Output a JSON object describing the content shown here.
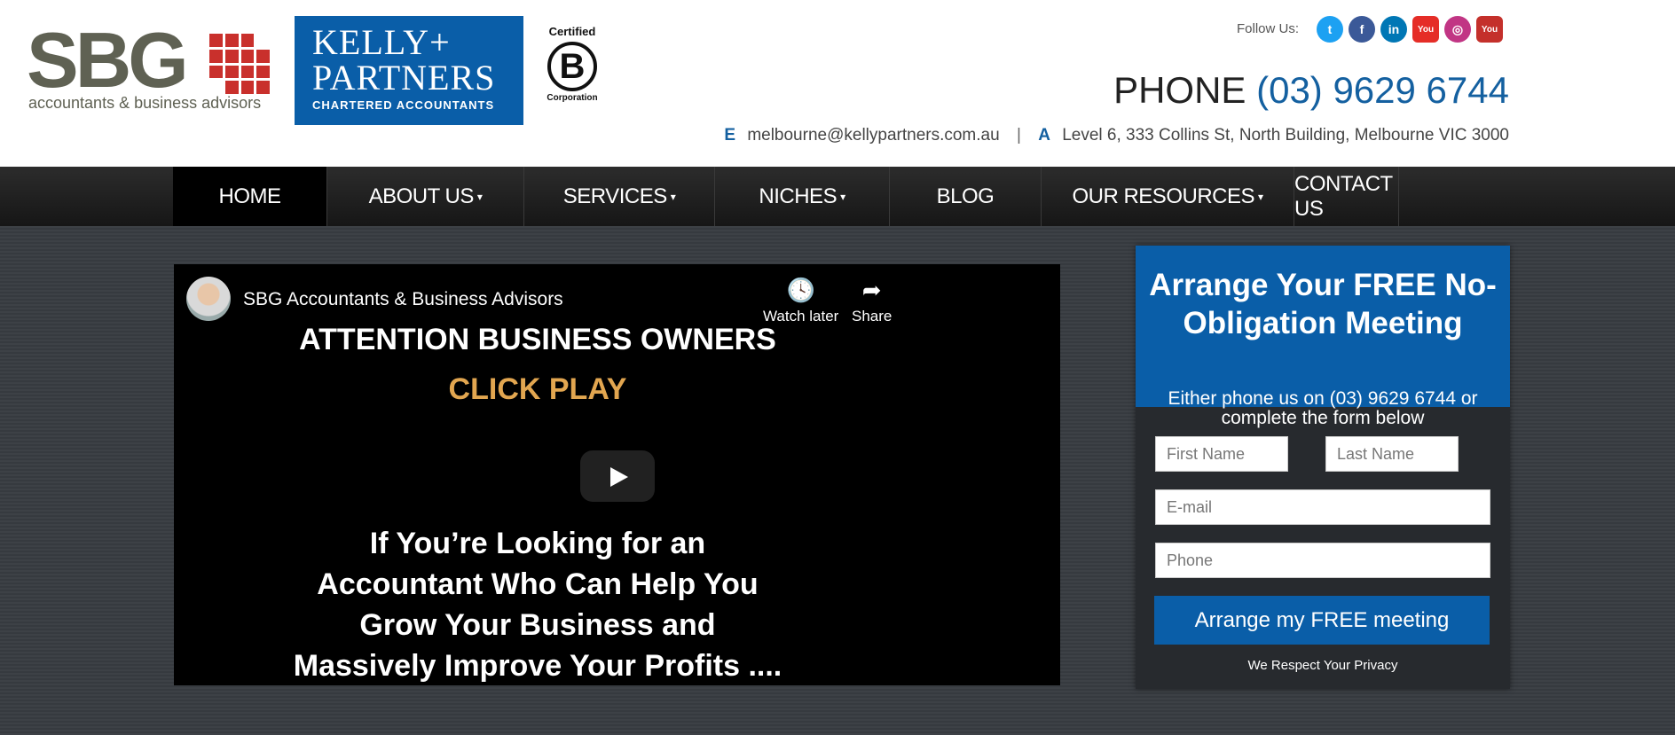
{
  "header": {
    "sbg_logo": {
      "wordmark": "SBG",
      "tagline": "accountants & business advisors"
    },
    "kp_logo": {
      "name_line1": "KELLY+",
      "name_line2": "PARTNERS",
      "sub": "CHARTERED ACCOUNTANTS"
    },
    "bcorp": {
      "top": "Certified",
      "letter": "B",
      "bottom": "Corporation"
    },
    "follow_label": "Follow Us:",
    "socials": [
      {
        "name": "twitter-icon",
        "glyph": "t",
        "color": "#1da1f2"
      },
      {
        "name": "facebook-icon",
        "glyph": "f",
        "color": "#3b5998"
      },
      {
        "name": "linkedin-icon",
        "glyph": "in",
        "color": "#0077b5"
      },
      {
        "name": "youtube-icon",
        "glyph": "You",
        "color": "#e52d27"
      },
      {
        "name": "instagram-icon",
        "glyph": "◎",
        "color": "#c13584"
      },
      {
        "name": "youtube-alt-icon",
        "glyph": "You",
        "color": "#c4302b"
      }
    ],
    "phone_label": "PHONE",
    "phone_number": "(03) 9629 6744",
    "email_label": "E",
    "email": "melbourne@kellypartners.com.au",
    "separator": "|",
    "address_label": "A",
    "address": "Level 6, 333 Collins St, North Building, Melbourne VIC 3000"
  },
  "nav": {
    "items": [
      {
        "label": "HOME",
        "dropdown": false,
        "active": true
      },
      {
        "label": "ABOUT US",
        "dropdown": true
      },
      {
        "label": "SERVICES",
        "dropdown": true
      },
      {
        "label": "NICHES",
        "dropdown": true
      },
      {
        "label": "BLOG",
        "dropdown": false
      },
      {
        "label": "OUR RESOURCES",
        "dropdown": true
      },
      {
        "label": "CONTACT US",
        "dropdown": false
      }
    ]
  },
  "video": {
    "channel_title": "SBG Accountants & Business Advisors",
    "watch_later": "Watch later",
    "share": "Share",
    "line1": "ATTENTION BUSINESS OWNERS",
    "line2": "CLICK PLAY",
    "text": "If You’re Looking for an Accountant Who Can Help You Grow Your Business and Massively Improve Your Profits ...."
  },
  "form": {
    "title": "Arrange Your FREE No-Obligation Meeting",
    "subtitle": "Either phone us on (03) 9629 6744 or complete the form below",
    "first_name_placeholder": "First Name",
    "last_name_placeholder": "Last Name",
    "email_placeholder": "E-mail",
    "phone_placeholder": "Phone",
    "submit_label": "Arrange my FREE meeting",
    "privacy": "We Respect Your Privacy"
  },
  "colors": {
    "brand_blue": "#0a5ea8",
    "accent_red": "#c9302c",
    "nav_bg": "#1e1e1e"
  }
}
